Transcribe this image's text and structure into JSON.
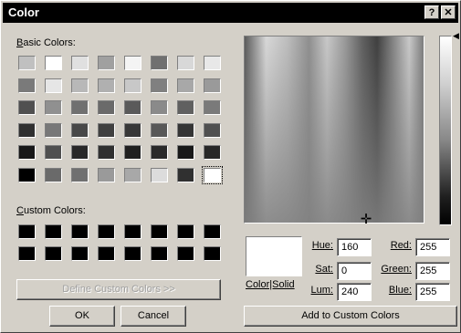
{
  "window": {
    "title": "Color",
    "help_glyph": "?",
    "close_glyph": "✕"
  },
  "basic_colors": {
    "label": "Basic Colors:",
    "label_first": "B",
    "label_rest": "asic Colors:",
    "swatches": [
      [
        "#c0c0c0",
        "#ffffff",
        "#e0e0e0",
        "#a0a0a0",
        "#f4f4f4",
        "#707070",
        "#d8d8d8",
        "#e8e8e8"
      ],
      [
        "#7a7a7a",
        "#e6e6e6",
        "#b8b8b8",
        "#b0b0b0",
        "#c8c8c8",
        "#808080",
        "#a8a8a8",
        "#9a9a9a"
      ],
      [
        "#505050",
        "#909090",
        "#707070",
        "#6a6a6a",
        "#5a5a5a",
        "#8a8a8a",
        "#606060",
        "#7a7a7a"
      ],
      [
        "#303030",
        "#787878",
        "#484848",
        "#404040",
        "#383838",
        "#585858",
        "#353535",
        "#505050"
      ],
      [
        "#181818",
        "#505050",
        "#282828",
        "#303030",
        "#202020",
        "#2a2a2a",
        "#181818",
        "#282828"
      ],
      [
        "#000000",
        "#6a6a6a",
        "#707070",
        "#9a9a9a",
        "#a8a8a8",
        "#dcdcdc",
        "#303030",
        "#ffffff"
      ]
    ]
  },
  "custom_colors": {
    "label_first": "C",
    "label_rest": "ustom Colors:",
    "swatches": [
      [
        "#000000",
        "#000000",
        "#000000",
        "#000000",
        "#000000",
        "#000000",
        "#000000",
        "#000000"
      ],
      [
        "#000000",
        "#000000",
        "#000000",
        "#000000",
        "#000000",
        "#000000",
        "#000000",
        "#000000"
      ]
    ]
  },
  "buttons": {
    "define_custom": "Define Custom Colors >>",
    "ok": "OK",
    "cancel": "Cancel",
    "add_custom": "Add to Custom Colors"
  },
  "preview": {
    "label": "Color|Solid",
    "color": "#ffffff"
  },
  "fields": {
    "hue": {
      "label": "Hue:",
      "value": "160"
    },
    "sat": {
      "label": "Sat:",
      "value": "0"
    },
    "lum": {
      "label": "Lum:",
      "value": "240"
    },
    "red": {
      "label": "Red:",
      "value": "255"
    },
    "green": {
      "label": "Green:",
      "value": "255"
    },
    "blue": {
      "label": "Blue:",
      "value": "255"
    }
  }
}
